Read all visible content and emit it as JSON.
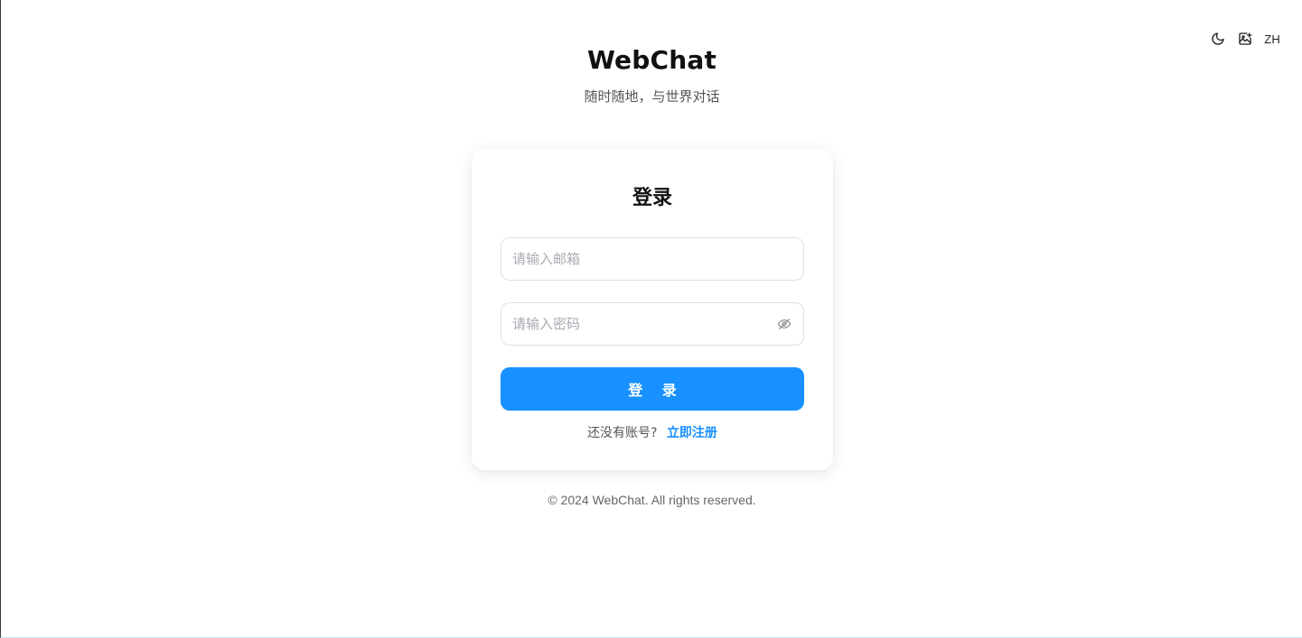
{
  "header": {
    "theme_icon": "moon-icon",
    "image_icon": "image-plus-icon",
    "language": "ZH"
  },
  "brand": {
    "title": "WebChat",
    "subtitle": "随时随地，与世界对话"
  },
  "login_card": {
    "title": "登录",
    "email": {
      "value": "",
      "placeholder": "请输入邮箱"
    },
    "password": {
      "value": "",
      "placeholder": "请输入密码",
      "toggle_icon": "eye-off-icon"
    },
    "submit_label": "登 录",
    "register_prompt": "还没有账号?",
    "register_link": "立即注册"
  },
  "footer": {
    "copyright": "© 2024 WebChat. All rights reserved."
  },
  "colors": {
    "accent": "#1890ff",
    "text_primary": "#111111",
    "text_secondary": "#555555",
    "border": "#dcdfe6"
  }
}
